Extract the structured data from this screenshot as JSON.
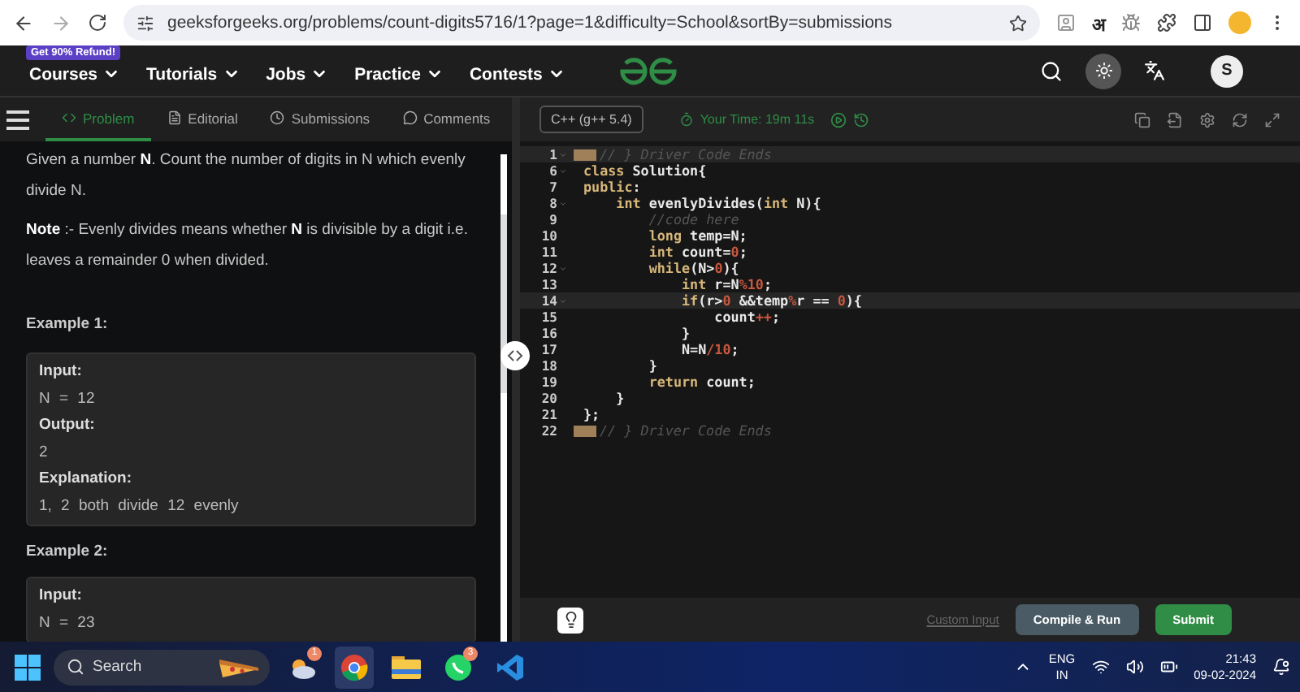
{
  "browser": {
    "url": "geeksforgeeks.org/problems/count-digits5716/1?page=1&difficulty=School&sortBy=submissions",
    "extension_text": "अ"
  },
  "site_nav": {
    "promo": "Get 90% Refund!",
    "menus": [
      "Courses",
      "Tutorials",
      "Jobs",
      "Practice",
      "Contests"
    ],
    "avatar": "S"
  },
  "problem_tabs": [
    {
      "label": "Problem",
      "kind": "code",
      "selected": true
    },
    {
      "label": "Editorial",
      "kind": "doc",
      "selected": false
    },
    {
      "label": "Submissions",
      "kind": "clock",
      "selected": false
    },
    {
      "label": "Comments",
      "kind": "chat",
      "selected": false
    }
  ],
  "problem": {
    "paragraphs": [
      "Given a number **N**. Count the number of digits in N which evenly divide N.",
      "**Note** :- Evenly divides means whether **N** is divisible by a digit i.e. leaves a remainder 0 when divided."
    ],
    "examples": [
      {
        "title": "Example 1:",
        "lines": [
          {
            "kind": "label",
            "text": "Input:"
          },
          {
            "kind": "value",
            "text": "N = 12"
          },
          {
            "kind": "label",
            "text": "Output:"
          },
          {
            "kind": "value",
            "text": "2"
          },
          {
            "kind": "label",
            "text": "Explanation:"
          },
          {
            "kind": "value",
            "text": "1, 2 both divide 12 evenly"
          }
        ]
      },
      {
        "title": "Example 2:",
        "lines": [
          {
            "kind": "label",
            "text": "Input:"
          },
          {
            "kind": "value",
            "text": "N = 23"
          }
        ]
      }
    ]
  },
  "editor": {
    "language": "C++ (g++ 5.4)",
    "timer": "Your Time: 19m 11s",
    "lines": [
      {
        "number": "1",
        "foldable": true,
        "highlighted": true,
        "marker": true,
        "tokens": [
          {
            "kind": "comment",
            "text": "// } Driver Code Ends"
          }
        ]
      },
      {
        "number": "6",
        "foldable": true,
        "highlighted": false,
        "marker": false,
        "tokens": [
          {
            "kind": "keyword",
            "text": "class"
          },
          {
            "kind": "plain",
            "text": " Solution{"
          }
        ]
      },
      {
        "number": "7",
        "foldable": false,
        "highlighted": false,
        "marker": false,
        "tokens": [
          {
            "kind": "keyword",
            "text": "public"
          },
          {
            "kind": "plain",
            "text": ":"
          }
        ]
      },
      {
        "number": "8",
        "foldable": true,
        "highlighted": false,
        "marker": false,
        "tokens": [
          {
            "kind": "keyword",
            "text": "    int"
          },
          {
            "kind": "plain",
            "text": " evenlyDivides("
          },
          {
            "kind": "keyword",
            "text": "int"
          },
          {
            "kind": "plain",
            "text": " N){"
          }
        ]
      },
      {
        "number": "9",
        "foldable": false,
        "highlighted": false,
        "marker": false,
        "tokens": [
          {
            "kind": "comment",
            "text": "        //code here"
          }
        ]
      },
      {
        "number": "10",
        "foldable": false,
        "highlighted": false,
        "marker": false,
        "tokens": [
          {
            "kind": "keyword",
            "text": "        long"
          },
          {
            "kind": "plain",
            "text": " temp=N;"
          }
        ]
      },
      {
        "number": "11",
        "foldable": false,
        "highlighted": false,
        "marker": false,
        "tokens": [
          {
            "kind": "keyword",
            "text": "        int"
          },
          {
            "kind": "plain",
            "text": " count="
          },
          {
            "kind": "number",
            "text": "0"
          },
          {
            "kind": "plain",
            "text": ";"
          }
        ]
      },
      {
        "number": "12",
        "foldable": true,
        "highlighted": false,
        "marker": false,
        "tokens": [
          {
            "kind": "keyword",
            "text": "        while"
          },
          {
            "kind": "plain",
            "text": "(N>"
          },
          {
            "kind": "number",
            "text": "0"
          },
          {
            "kind": "plain",
            "text": "){"
          }
        ]
      },
      {
        "number": "13",
        "foldable": false,
        "highlighted": false,
        "marker": false,
        "tokens": [
          {
            "kind": "keyword",
            "text": "            int"
          },
          {
            "kind": "plain",
            "text": " r=N"
          },
          {
            "kind": "number",
            "text": "%10"
          },
          {
            "kind": "plain",
            "text": ";"
          }
        ]
      },
      {
        "number": "14",
        "foldable": true,
        "highlighted": true,
        "marker": false,
        "tokens": [
          {
            "kind": "keyword",
            "text": "            if"
          },
          {
            "kind": "plain",
            "text": "(r>"
          },
          {
            "kind": "number",
            "text": "0"
          },
          {
            "kind": "plain",
            "text": " &&temp"
          },
          {
            "kind": "number",
            "text": "%"
          },
          {
            "kind": "plain",
            "text": "r == "
          },
          {
            "kind": "number",
            "text": "0"
          },
          {
            "kind": "plain",
            "text": "){"
          }
        ]
      },
      {
        "number": "15",
        "foldable": false,
        "highlighted": false,
        "marker": false,
        "tokens": [
          {
            "kind": "plain",
            "text": "                count"
          },
          {
            "kind": "number",
            "text": "++"
          },
          {
            "kind": "plain",
            "text": ";"
          }
        ]
      },
      {
        "number": "16",
        "foldable": false,
        "highlighted": false,
        "marker": false,
        "tokens": [
          {
            "kind": "plain",
            "text": "            }"
          }
        ]
      },
      {
        "number": "17",
        "foldable": false,
        "highlighted": false,
        "marker": false,
        "tokens": [
          {
            "kind": "plain",
            "text": "            N=N"
          },
          {
            "kind": "number",
            "text": "/10"
          },
          {
            "kind": "plain",
            "text": ";"
          }
        ]
      },
      {
        "number": "18",
        "foldable": false,
        "highlighted": false,
        "marker": false,
        "tokens": [
          {
            "kind": "plain",
            "text": "        }"
          }
        ]
      },
      {
        "number": "19",
        "foldable": false,
        "highlighted": false,
        "marker": false,
        "tokens": [
          {
            "kind": "keyword",
            "text": "        return"
          },
          {
            "kind": "plain",
            "text": " count;"
          }
        ]
      },
      {
        "number": "20",
        "foldable": false,
        "highlighted": false,
        "marker": false,
        "tokens": [
          {
            "kind": "plain",
            "text": "    }"
          }
        ]
      },
      {
        "number": "21",
        "foldable": false,
        "highlighted": false,
        "marker": false,
        "tokens": [
          {
            "kind": "plain",
            "text": "};"
          }
        ]
      },
      {
        "number": "22",
        "foldable": false,
        "highlighted": false,
        "marker": true,
        "tokens": [
          {
            "kind": "comment",
            "text": "// } Driver Code Ends"
          }
        ]
      }
    ]
  },
  "actions": {
    "custom_input": "Custom Input",
    "buttons": [
      {
        "label": "Compile & Run",
        "kind": "secondary"
      },
      {
        "label": "Submit",
        "kind": "primary"
      }
    ]
  },
  "taskbar": {
    "search": {
      "placeholder": "Search"
    },
    "apps": [
      {
        "kind": "weather",
        "badge": "1",
        "selected": false
      },
      {
        "kind": "chrome",
        "selected": true
      },
      {
        "kind": "folder",
        "selected": false
      },
      {
        "kind": "whatsapp",
        "badge": "3",
        "selected": false
      },
      {
        "kind": "vscode",
        "selected": false
      }
    ],
    "language": "ENG",
    "region": "IN",
    "time": "21:43",
    "date": "09-02-2024"
  }
}
